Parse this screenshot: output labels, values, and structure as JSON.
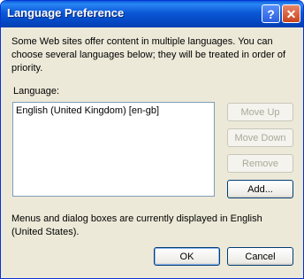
{
  "window": {
    "title": "Language Preference",
    "help_glyph": "?",
    "close_glyph": "✕"
  },
  "dialog": {
    "description": "Some Web sites offer content in multiple languages. You can choose several languages below; they will be treated in order of priority.",
    "list_label": "Language:",
    "languages": [
      "English (United Kingdom) [en-gb]"
    ],
    "buttons": {
      "move_up": "Move Up",
      "move_down": "Move Down",
      "remove": "Remove",
      "add": "Add..."
    },
    "note": "Menus and dialog boxes are currently displayed in English (United States).",
    "ok": "OK",
    "cancel": "Cancel"
  }
}
